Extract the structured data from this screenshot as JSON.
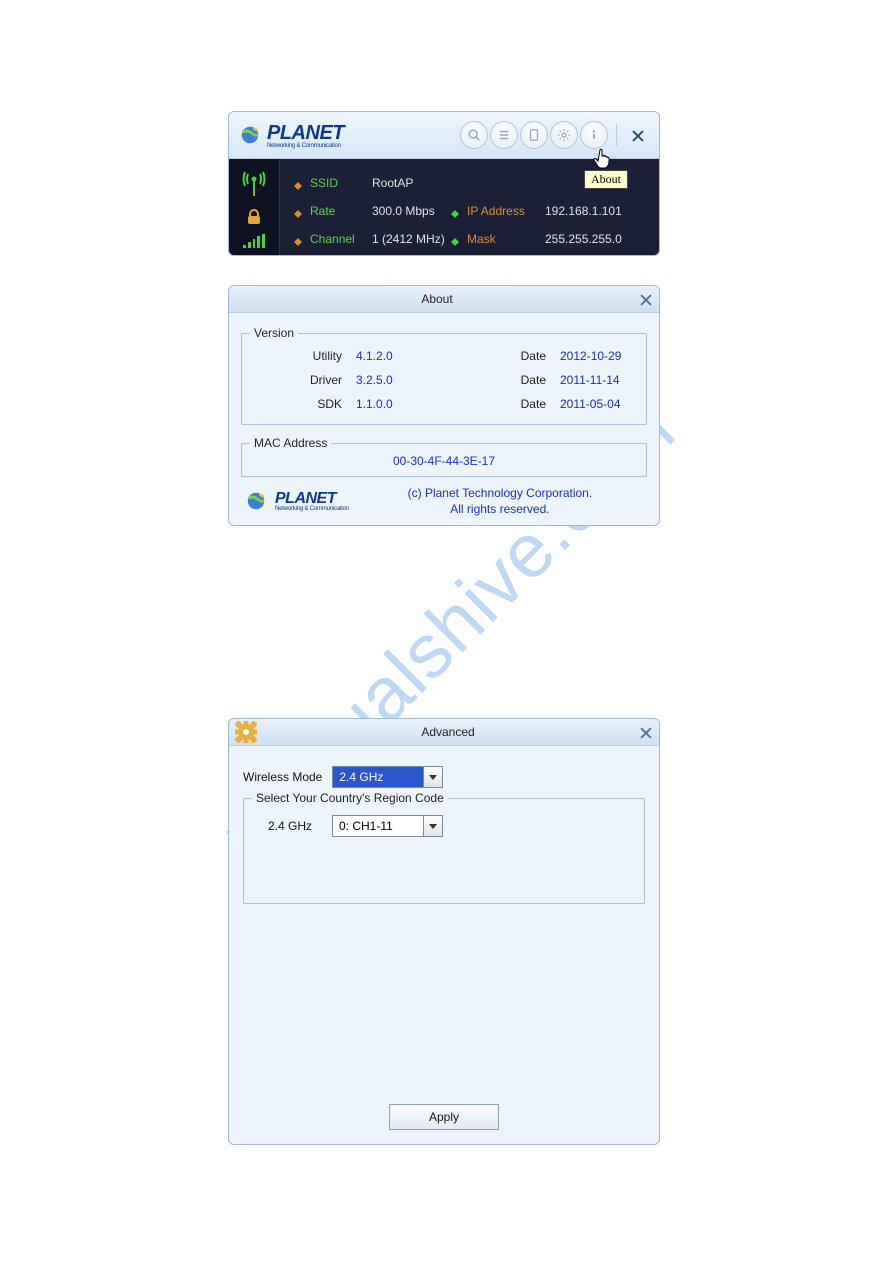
{
  "brand": {
    "name": "PLANET",
    "tagline": "Networking & Communication"
  },
  "header": {
    "tooltip_about": "About"
  },
  "status": {
    "ssid_label": "SSID",
    "ssid": "RootAP",
    "rate_label": "Rate",
    "rate": "300.0 Mbps",
    "channel_label": "Channel",
    "channel": "1 (2412 MHz)",
    "ip_label": "IP Address",
    "ip": "192.168.1.101",
    "mask_label": "Mask",
    "mask": "255.255.255.0"
  },
  "about": {
    "title": "About",
    "version_legend": "Version",
    "rows": [
      {
        "k": "Utility",
        "v": "4.1.2.0",
        "dk": "Date",
        "dv": "2012-10-29"
      },
      {
        "k": "Driver",
        "v": "3.2.5.0",
        "dk": "Date",
        "dv": "2011-11-14"
      },
      {
        "k": "SDK",
        "v": "1.1.0.0",
        "dk": "Date",
        "dv": "2011-05-04"
      }
    ],
    "mac_legend": "MAC Address",
    "mac": "00-30-4F-44-3E-17",
    "copyright_line1": "(c) Planet Technology Corporation.",
    "copyright_line2": "All rights reserved."
  },
  "advanced": {
    "title": "Advanced",
    "wireless_mode_label": "Wireless Mode",
    "wireless_mode_value": "2.4 GHz",
    "region_legend": "Select Your Country's Region Code",
    "band_label": "2.4 GHz",
    "region_value": "0: CH1-11",
    "apply_label": "Apply"
  },
  "watermark": "manualshive.com"
}
